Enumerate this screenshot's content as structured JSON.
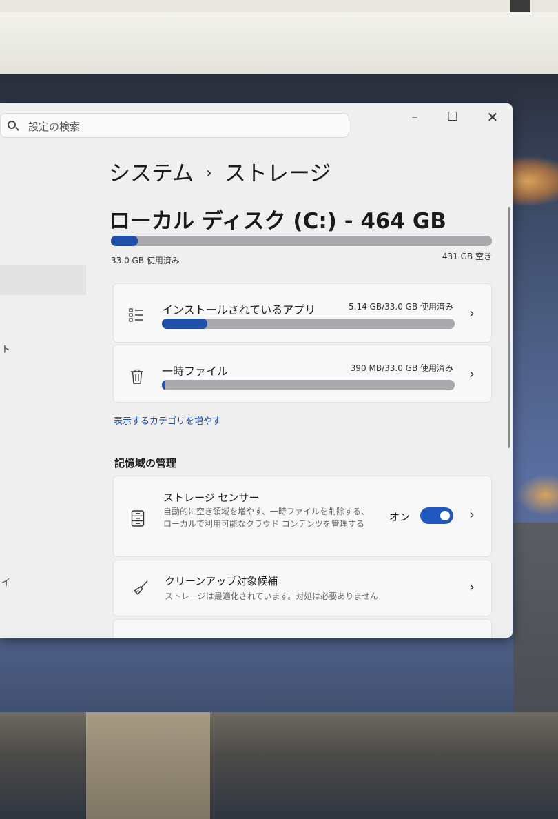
{
  "window": {
    "controls": {
      "minimize": "–",
      "maximize": "☐",
      "close": "✕"
    }
  },
  "search": {
    "placeholder": "設定の検索",
    "icon": "search-icon"
  },
  "nav": {
    "fragments": [
      "ト",
      "イ"
    ]
  },
  "breadcrumb": {
    "parent": "システム",
    "separator": "›",
    "current": "ストレージ"
  },
  "disk": {
    "title": "ローカル ディスク (C:) - 464 GB",
    "used_fraction": 0.071,
    "used_label": "33.0 GB 使用済み",
    "free_label": "431 GB 空き"
  },
  "categories": [
    {
      "label": "インストールされているアプリ",
      "usage": "5.14 GB/33.0 GB 使用済み",
      "fraction": 0.156,
      "icon": "list-icon"
    },
    {
      "label": "一時ファイル",
      "usage": "390 MB/33.0 GB 使用済み",
      "fraction": 0.012,
      "icon": "trash-icon"
    }
  ],
  "more_categories_link": "表示するカテゴリを増やす",
  "management": {
    "heading": "記憶域の管理",
    "storage_sense": {
      "title": "ストレージ センサー",
      "description": "自動的に空き領域を増やす、一時ファイルを削除する、ローカルで利用可能なクラウド コンテンツを管理する",
      "toggle_label": "オン",
      "toggle_on": true
    },
    "cleanup": {
      "title": "クリーンアップ対象候補",
      "description": "ストレージは最適化されています。対処は必要ありません"
    }
  },
  "colors": {
    "accent": "#1f4fa8",
    "link": "#1d4fa5",
    "bar_track": "#a9a9ad"
  }
}
